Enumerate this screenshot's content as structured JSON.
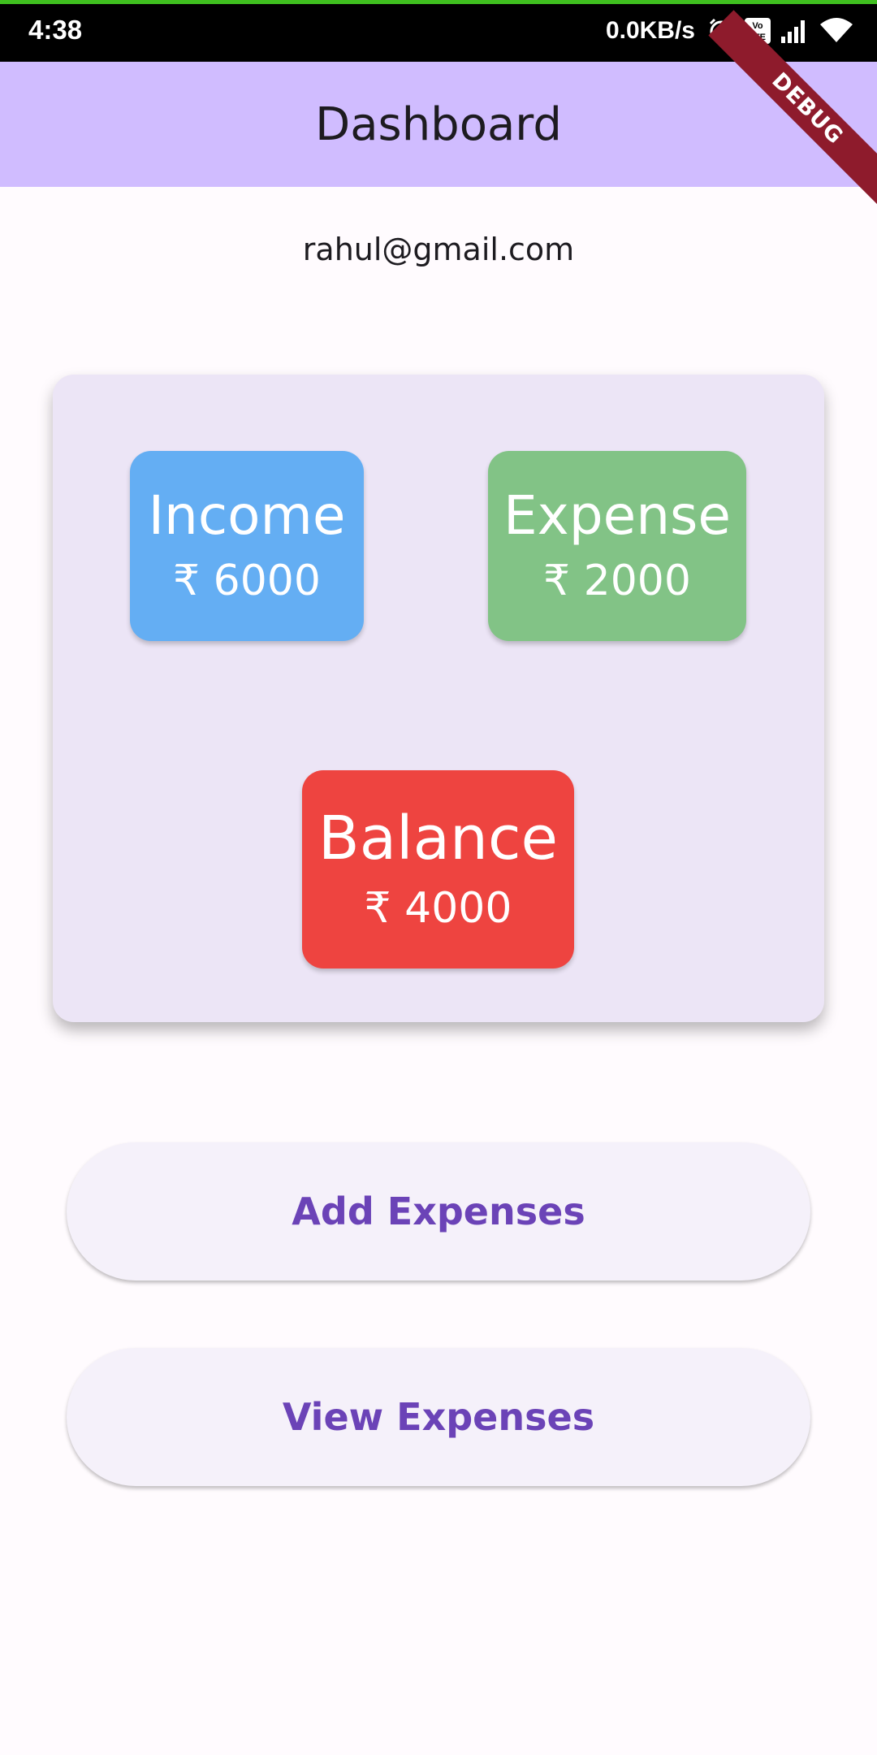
{
  "status_bar": {
    "time": "4:38",
    "network_speed": "0.0KB/s",
    "icons": [
      "alarm-icon",
      "volte-icon",
      "signal-icon",
      "wifi-icon"
    ]
  },
  "app_bar": {
    "title": "Dashboard"
  },
  "debug_banner": "DEBUG",
  "user": {
    "email": "rahul@gmail.com"
  },
  "summary": {
    "income": {
      "label": "Income",
      "value": "₹ 6000",
      "color": "#64aef3"
    },
    "expense": {
      "label": "Expense",
      "value": "₹ 2000",
      "color": "#82c386"
    },
    "balance": {
      "label": "Balance",
      "value": "₹ 4000",
      "color": "#ee4440"
    }
  },
  "actions": {
    "add_label": "Add Expenses",
    "view_label": "View Expenses"
  },
  "colors": {
    "app_bar": "#d0bcff",
    "card_bg": "#ece5f6",
    "button_text": "#6b43b7"
  }
}
